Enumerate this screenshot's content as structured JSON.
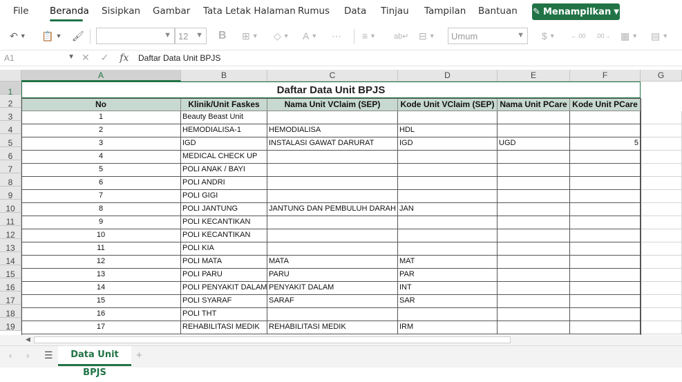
{
  "menu": {
    "file": "File",
    "beranda": "Beranda",
    "sisipkan": "Sisipkan",
    "gambar": "Gambar",
    "tata_letak": "Tata Letak Halaman",
    "rumus": "Rumus",
    "data": "Data",
    "tinjau": "Tinjau",
    "tampilan": "Tampilan",
    "bantuan": "Bantuan",
    "show_button": "Menampilkan"
  },
  "toolbar": {
    "font_size": "12",
    "number_format": "Umum"
  },
  "formula_bar": {
    "cell_ref": "A1",
    "content": "Daftar Data Unit BPJS"
  },
  "columns": [
    "A",
    "B",
    "C",
    "D",
    "E",
    "F",
    "G"
  ],
  "rows": [
    "1",
    "2",
    "3",
    "4",
    "5",
    "6",
    "7",
    "8",
    "9",
    "10",
    "11",
    "12",
    "13",
    "14",
    "15",
    "16",
    "17",
    "18",
    "19"
  ],
  "sheet": {
    "title": "Daftar Data Unit BPJS",
    "headers": [
      "No",
      "Klinik/Unit Faskes",
      "Nama Unit VClaim (SEP)",
      "Kode Unit VClaim (SEP)",
      "Nama Unit PCare",
      "Kode Unit PCare"
    ],
    "data": [
      [
        "1",
        "Beauty Beast Unit",
        "",
        "",
        "",
        ""
      ],
      [
        "2",
        "HEMODIALISA-1",
        "HEMODIALISA",
        "HDL",
        "",
        ""
      ],
      [
        "3",
        "IGD",
        "INSTALASI GAWAT DARURAT",
        "IGD",
        "UGD",
        "5"
      ],
      [
        "4",
        "MEDICAL CHECK UP",
        "",
        "",
        "",
        ""
      ],
      [
        "5",
        "POLI ANAK / BAYI",
        "",
        "",
        "",
        ""
      ],
      [
        "6",
        "POLI ANDRI",
        "",
        "",
        "",
        ""
      ],
      [
        "7",
        "POLI GIGI",
        "",
        "",
        "",
        ""
      ],
      [
        "8",
        "POLI JANTUNG",
        "JANTUNG DAN PEMBULUH DARAH",
        "JAN",
        "",
        ""
      ],
      [
        "9",
        "POLI KECANTIKAN",
        "",
        "",
        "",
        ""
      ],
      [
        "10",
        "POLI KECANTIKAN",
        "",
        "",
        "",
        ""
      ],
      [
        "11",
        "POLI KIA",
        "",
        "",
        "",
        ""
      ],
      [
        "12",
        "POLI MATA",
        "MATA",
        "MAT",
        "",
        ""
      ],
      [
        "13",
        "POLI PARU",
        "PARU",
        "PAR",
        "",
        ""
      ],
      [
        "14",
        "POLI PENYAKIT DALAM",
        "PENYAKIT DALAM",
        "INT",
        "",
        ""
      ],
      [
        "15",
        "POLI SYARAF",
        "SARAF",
        "SAR",
        "",
        ""
      ],
      [
        "16",
        "POLI THT",
        "",
        "",
        "",
        ""
      ],
      [
        "17",
        "REHABILITASI MEDIK",
        "REHABILITASI MEDIK",
        "IRM",
        "",
        ""
      ]
    ]
  },
  "sheet_tab": "Data Unit BPJS",
  "colors": {
    "accent": "#217346",
    "header_fill": "#c7d9d0"
  }
}
